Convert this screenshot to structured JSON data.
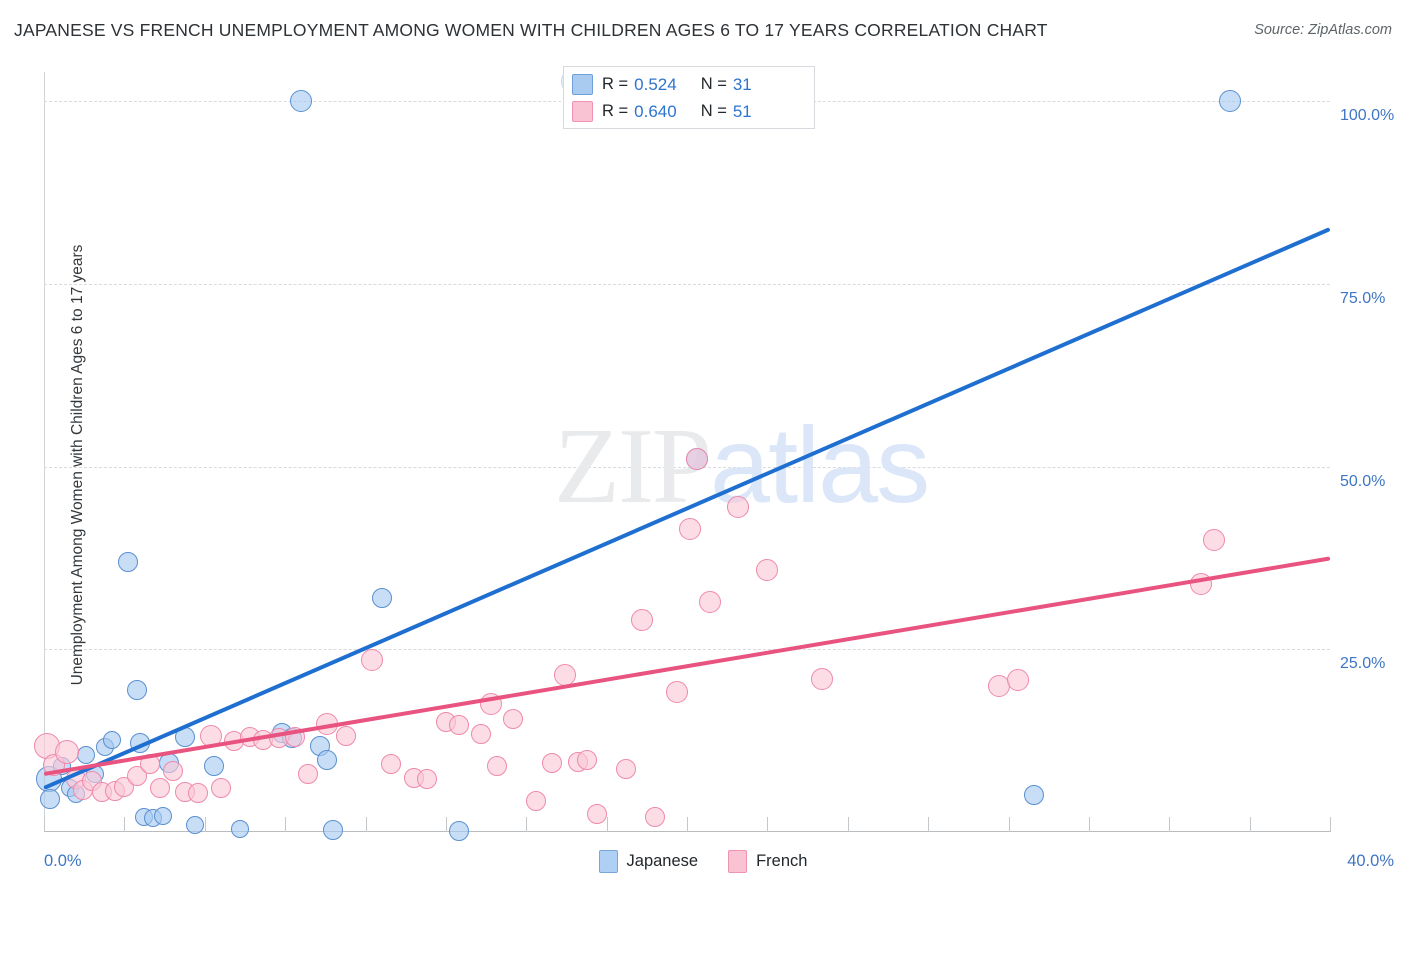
{
  "header": {
    "title": "JAPANESE VS FRENCH UNEMPLOYMENT AMONG WOMEN WITH CHILDREN AGES 6 TO 17 YEARS CORRELATION CHART",
    "source": "Source: ZipAtlas.com"
  },
  "watermark": {
    "part1": "ZIP",
    "part2": "atlas"
  },
  "stats": {
    "japanese": {
      "r_label": "R =",
      "r_value": "0.524",
      "n_label": "N =",
      "n_value": "31"
    },
    "french": {
      "r_label": "R =",
      "r_value": "0.640",
      "n_label": "N =",
      "n_value": "51"
    }
  },
  "legend": {
    "items": [
      {
        "label": "Japanese",
        "color": "#aed0f4"
      },
      {
        "label": "French",
        "color": "#f9c3d3"
      }
    ]
  },
  "chart_data": {
    "type": "scatter",
    "title": "JAPANESE VS FRENCH UNEMPLOYMENT AMONG WOMEN WITH CHILDREN AGES 6 TO 17 YEARS CORRELATION CHART",
    "xlabel": "",
    "ylabel": "Unemployment Among Women with Children Ages 6 to 17 years",
    "xlim": [
      0,
      40
    ],
    "ylim": [
      0,
      104
    ],
    "grid": true,
    "legend_position": "bottom-center",
    "x_tick_labels": [
      "0.0%",
      "40.0%"
    ],
    "y_tick_labels": [
      "25.0%",
      "50.0%",
      "75.0%",
      "100.0%"
    ],
    "y_ticks": [
      25,
      50,
      75,
      100
    ],
    "accent_colors": {
      "japanese_fill": "#a7c9f0",
      "japanese_stroke": "#5b90d0",
      "japanese_line": "#1f6fd0",
      "french_fill": "#fac8d7",
      "french_stroke": "#ef89ab",
      "french_line": "#e8537f",
      "axis_label": "#3f76c4"
    },
    "series": [
      {
        "name": "Japanese",
        "r": 0.524,
        "n": 31,
        "trendline": {
          "x0": 0.0,
          "y0": 6.0,
          "x1": 40.0,
          "y1": 82.5
        },
        "points": [
          {
            "x": 0.15,
            "y": 7.2,
            "r": 13
          },
          {
            "x": 0.2,
            "y": 4.5,
            "r": 10
          },
          {
            "x": 0.55,
            "y": 9.0,
            "r": 9
          },
          {
            "x": 0.8,
            "y": 6.0,
            "r": 9
          },
          {
            "x": 1.0,
            "y": 5.2,
            "r": 9
          },
          {
            "x": 1.3,
            "y": 10.5,
            "r": 9
          },
          {
            "x": 1.6,
            "y": 8.0,
            "r": 9
          },
          {
            "x": 1.9,
            "y": 11.6,
            "r": 9
          },
          {
            "x": 2.1,
            "y": 12.6,
            "r": 9
          },
          {
            "x": 2.6,
            "y": 37.0,
            "r": 10
          },
          {
            "x": 2.9,
            "y": 19.5,
            "r": 10
          },
          {
            "x": 3.0,
            "y": 12.2,
            "r": 10
          },
          {
            "x": 3.1,
            "y": 2.1,
            "r": 9
          },
          {
            "x": 3.4,
            "y": 1.9,
            "r": 9
          },
          {
            "x": 3.7,
            "y": 2.2,
            "r": 9
          },
          {
            "x": 3.9,
            "y": 9.5,
            "r": 10
          },
          {
            "x": 4.4,
            "y": 13.0,
            "r": 10
          },
          {
            "x": 4.7,
            "y": 1.0,
            "r": 9
          },
          {
            "x": 5.3,
            "y": 9.0,
            "r": 10
          },
          {
            "x": 6.1,
            "y": 0.4,
            "r": 9
          },
          {
            "x": 7.4,
            "y": 13.5,
            "r": 10
          },
          {
            "x": 7.7,
            "y": 12.9,
            "r": 10
          },
          {
            "x": 8.0,
            "y": 100.0,
            "r": 11
          },
          {
            "x": 8.6,
            "y": 11.8,
            "r": 10
          },
          {
            "x": 8.8,
            "y": 9.8,
            "r": 10
          },
          {
            "x": 9.0,
            "y": 0.3,
            "r": 10
          },
          {
            "x": 10.5,
            "y": 32.0,
            "r": 10
          },
          {
            "x": 12.9,
            "y": 0.2,
            "r": 10
          },
          {
            "x": 20.3,
            "y": 51.0,
            "r": 11
          },
          {
            "x": 30.8,
            "y": 5.0,
            "r": 10
          },
          {
            "x": 36.9,
            "y": 100.0,
            "r": 11
          }
        ]
      },
      {
        "name": "French",
        "r": 0.64,
        "n": 51,
        "trendline": {
          "x0": 0.0,
          "y0": 8.0,
          "x1": 40.0,
          "y1": 37.5
        },
        "points": [
          {
            "x": 0.1,
            "y": 11.8,
            "r": 13
          },
          {
            "x": 0.3,
            "y": 9.2,
            "r": 11
          },
          {
            "x": 0.7,
            "y": 11.0,
            "r": 12
          },
          {
            "x": 1.0,
            "y": 7.2,
            "r": 10
          },
          {
            "x": 1.2,
            "y": 5.8,
            "r": 10
          },
          {
            "x": 1.5,
            "y": 7.0,
            "r": 10
          },
          {
            "x": 1.8,
            "y": 5.5,
            "r": 10
          },
          {
            "x": 2.2,
            "y": 5.6,
            "r": 10
          },
          {
            "x": 2.5,
            "y": 6.2,
            "r": 10
          },
          {
            "x": 2.9,
            "y": 7.6,
            "r": 10
          },
          {
            "x": 3.3,
            "y": 9.3,
            "r": 10
          },
          {
            "x": 3.6,
            "y": 6.0,
            "r": 10
          },
          {
            "x": 4.0,
            "y": 8.3,
            "r": 10
          },
          {
            "x": 4.4,
            "y": 5.5,
            "r": 10
          },
          {
            "x": 4.8,
            "y": 5.3,
            "r": 10
          },
          {
            "x": 5.2,
            "y": 13.2,
            "r": 11
          },
          {
            "x": 5.5,
            "y": 6.0,
            "r": 10
          },
          {
            "x": 5.9,
            "y": 12.5,
            "r": 10
          },
          {
            "x": 6.4,
            "y": 13.0,
            "r": 10
          },
          {
            "x": 6.8,
            "y": 12.6,
            "r": 10
          },
          {
            "x": 7.3,
            "y": 12.8,
            "r": 10
          },
          {
            "x": 7.8,
            "y": 13.0,
            "r": 10
          },
          {
            "x": 8.2,
            "y": 8.0,
            "r": 10
          },
          {
            "x": 8.8,
            "y": 14.8,
            "r": 11
          },
          {
            "x": 9.4,
            "y": 13.2,
            "r": 10
          },
          {
            "x": 10.2,
            "y": 23.5,
            "r": 11
          },
          {
            "x": 10.8,
            "y": 9.3,
            "r": 10
          },
          {
            "x": 11.5,
            "y": 7.4,
            "r": 10
          },
          {
            "x": 11.9,
            "y": 7.2,
            "r": 10
          },
          {
            "x": 12.5,
            "y": 15.0,
            "r": 10
          },
          {
            "x": 12.9,
            "y": 14.6,
            "r": 10
          },
          {
            "x": 13.6,
            "y": 13.4,
            "r": 10
          },
          {
            "x": 13.9,
            "y": 17.5,
            "r": 11
          },
          {
            "x": 14.1,
            "y": 9.0,
            "r": 10
          },
          {
            "x": 14.6,
            "y": 15.5,
            "r": 10
          },
          {
            "x": 15.3,
            "y": 4.2,
            "r": 10
          },
          {
            "x": 15.8,
            "y": 9.4,
            "r": 10
          },
          {
            "x": 16.2,
            "y": 21.5,
            "r": 11
          },
          {
            "x": 16.6,
            "y": 9.6,
            "r": 10
          },
          {
            "x": 16.9,
            "y": 9.9,
            "r": 10
          },
          {
            "x": 17.2,
            "y": 2.5,
            "r": 10
          },
          {
            "x": 18.1,
            "y": 8.6,
            "r": 10
          },
          {
            "x": 18.6,
            "y": 29.0,
            "r": 11
          },
          {
            "x": 19.0,
            "y": 2.0,
            "r": 10
          },
          {
            "x": 19.7,
            "y": 19.2,
            "r": 11
          },
          {
            "x": 20.1,
            "y": 41.5,
            "r": 11
          },
          {
            "x": 20.3,
            "y": 51.0,
            "r": 11
          },
          {
            "x": 20.7,
            "y": 31.5,
            "r": 11
          },
          {
            "x": 21.6,
            "y": 44.5,
            "r": 11
          },
          {
            "x": 22.5,
            "y": 35.8,
            "r": 11
          },
          {
            "x": 24.2,
            "y": 21.0,
            "r": 11
          },
          {
            "x": 29.7,
            "y": 20.0,
            "r": 11
          },
          {
            "x": 30.3,
            "y": 20.8,
            "r": 11
          },
          {
            "x": 36.0,
            "y": 34.0,
            "r": 11
          },
          {
            "x": 36.4,
            "y": 40.0,
            "r": 11
          }
        ]
      }
    ]
  }
}
